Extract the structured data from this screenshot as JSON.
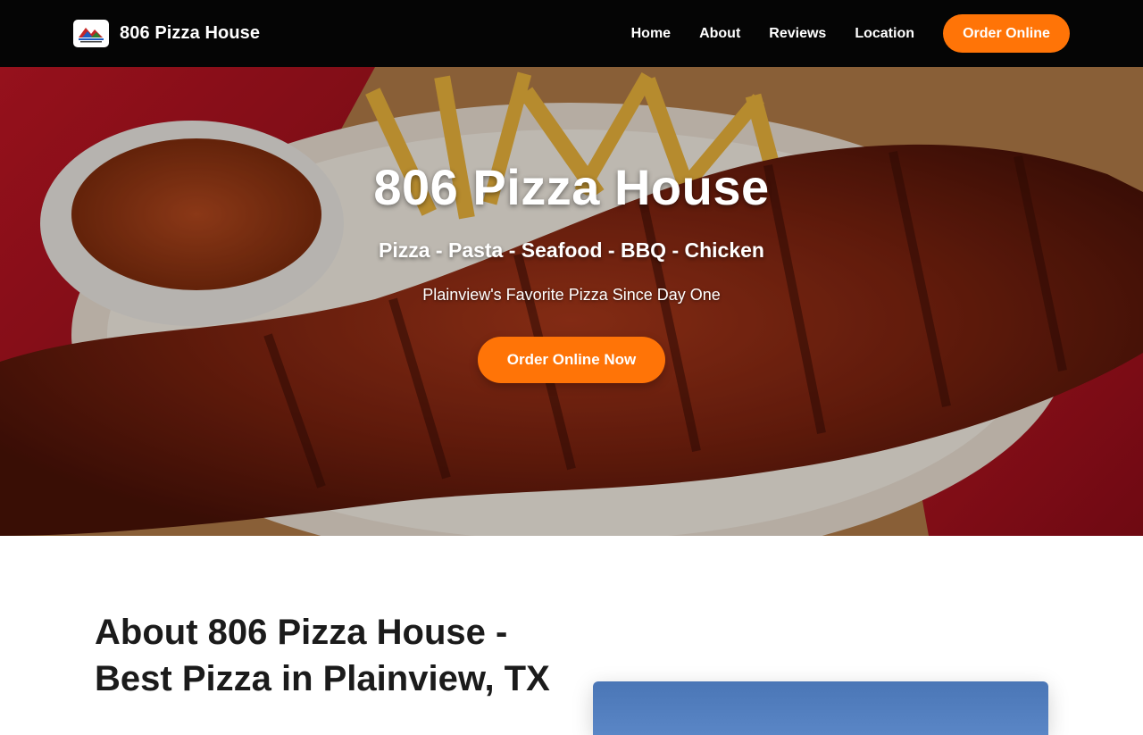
{
  "header": {
    "brand_name": "806 Pizza House",
    "logo_icon": "pizza-house-logo",
    "nav": [
      {
        "label": "Home"
      },
      {
        "label": "About"
      },
      {
        "label": "Reviews"
      },
      {
        "label": "Location"
      }
    ],
    "order_label": "Order Online",
    "accent_color": "#ff7407"
  },
  "hero": {
    "title": "806 Pizza House",
    "tagline": "Pizza - Pasta - Seafood - BBQ - Chicken",
    "subtitle": "Plainview's Favorite Pizza Since Day One",
    "cta_label": "Order Online Now"
  },
  "about": {
    "title": "About 806 Pizza House - Best Pizza in Plainview, TX"
  }
}
